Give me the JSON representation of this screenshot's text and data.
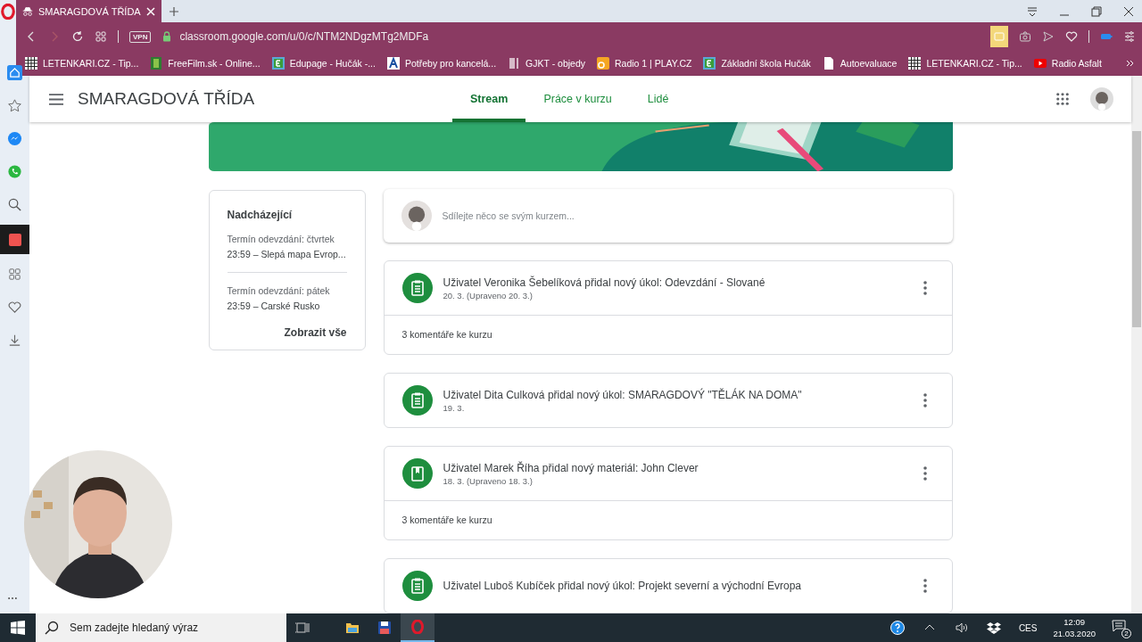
{
  "browser": {
    "tab": {
      "title": "SMARAGDOVÁ TŘÍDA"
    },
    "vpn": "VPN",
    "url": "classroom.google.com/u/0/c/NTM2NDgzMTg2MDFa",
    "bookmarks": [
      {
        "label": "LETENKARI.CZ - Tip...",
        "kind": "grid"
      },
      {
        "label": "FreeFilm.sk - Online...",
        "kind": "film"
      },
      {
        "label": "Edupage - Hučák -...",
        "kind": "edu"
      },
      {
        "label": "Potřeby pro kancelá...",
        "kind": "letter"
      },
      {
        "label": "GJKT - objedy",
        "kind": "fork"
      },
      {
        "label": "Radio 1 | PLAY.CZ",
        "kind": "radio"
      },
      {
        "label": "Základní škola Hučák",
        "kind": "edu"
      },
      {
        "label": "Autoevaluace",
        "kind": "doc"
      },
      {
        "label": "LETENKARI.CZ - Tip...",
        "kind": "grid"
      },
      {
        "label": "Radio Asfalt",
        "kind": "video"
      }
    ]
  },
  "app": {
    "title": "SMARAGDOVÁ TŘÍDA",
    "tabs": [
      {
        "label": "Stream",
        "selected": true
      },
      {
        "label": "Práce v kurzu",
        "selected": false
      },
      {
        "label": "Lidé",
        "selected": false
      }
    ]
  },
  "upcoming": {
    "title": "Nadcházející",
    "items": [
      {
        "due": "Termín odevzdání: čtvrtek",
        "task": "23:59 – Slepá mapa Evrop..."
      },
      {
        "due": "Termín odevzdání: pátek",
        "task": "23:59 – Carské Rusko"
      }
    ],
    "link": "Zobrazit vše"
  },
  "share": {
    "placeholder": "Sdílejte něco se svým kurzem..."
  },
  "posts": [
    {
      "kind": "assignment",
      "title": "Uživatel Veronika Šebelíková přidal nový úkol: Odevzdání - Slované",
      "date": "20. 3. (Upraveno 20. 3.)",
      "comments": "3 komentáře ke kurzu"
    },
    {
      "kind": "assignment",
      "title": "Uživatel Dita Culková přidal nový úkol: SMARAGDOVÝ \"TĚLÁK NA DOMA\"",
      "date": "19. 3."
    },
    {
      "kind": "material",
      "title": "Uživatel Marek Říha přidal nový materiál: John Clever",
      "date": "18. 3. (Upraveno 18. 3.)",
      "comments": "3 komentáře ke kurzu"
    },
    {
      "kind": "assignment",
      "title": "Uživatel Luboš Kubíček přidal nový úkol: Projekt severní a východní Evropa"
    }
  ],
  "taskbar": {
    "search": {
      "placeholder": "Sem zadejte hledaný výraz"
    },
    "language": "CES",
    "time": "12:09",
    "date": "21.03.2020",
    "notifications": "2"
  }
}
